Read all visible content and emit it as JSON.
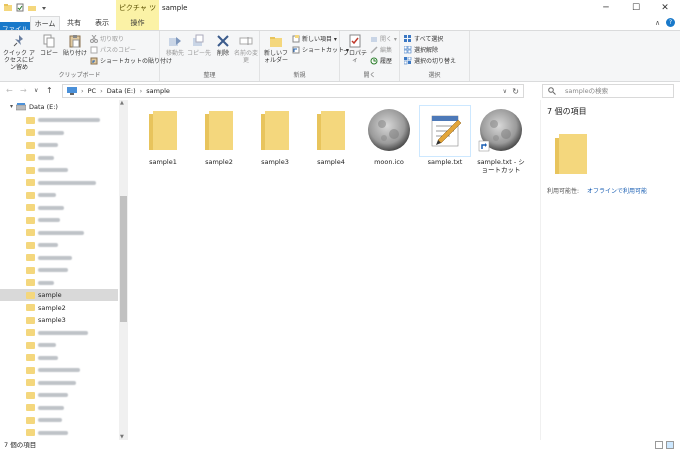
{
  "window": {
    "title": "sample",
    "context_tab": "ピクチャ ツール",
    "minimize": "─",
    "maximize": "☐",
    "close": "✕"
  },
  "tabs": [
    {
      "label": "ファイル"
    },
    {
      "label": "ホーム"
    },
    {
      "label": "共有"
    },
    {
      "label": "表示"
    },
    {
      "label": "操作"
    }
  ],
  "ribbon": {
    "clipboard": {
      "label": "クリップボード",
      "pin": "クイック アクセスにピン留め",
      "copy": "コピー",
      "paste": "貼り付け",
      "cut": "切り取り",
      "copy_path": "パスのコピー",
      "paste_shortcut": "ショートカットの貼り付け"
    },
    "organize": {
      "label": "整理",
      "move_to": "移動先",
      "copy_to": "コピー先",
      "delete": "削除",
      "rename": "名前の変更"
    },
    "new": {
      "label": "新規",
      "new_folder": "新しいフォルダー",
      "new_item": "新しい項目 ▾",
      "shortcut": "ショートカット ▾"
    },
    "open": {
      "label": "開く",
      "properties": "プロパティ",
      "open": "開く ▾",
      "edit": "編集",
      "history": "履歴"
    },
    "select": {
      "label": "選択",
      "select_all": "すべて選択",
      "select_none": "選択解除",
      "invert": "選択の切り替え"
    }
  },
  "address": {
    "back": "←",
    "forward": "→",
    "recent": "∨",
    "up": "↑",
    "crumbs": [
      "PC",
      "Data (E:)",
      "sample"
    ],
    "sep": "›",
    "refresh": "↻",
    "dropdown": "∨",
    "search_placeholder": "sampleの検索"
  },
  "nav": {
    "drive": "Data (E:)",
    "items": [
      {
        "label": "",
        "blur": 62
      },
      {
        "label": "",
        "blur": 26
      },
      {
        "label": "",
        "blur": 20
      },
      {
        "label": "",
        "blur": 16
      },
      {
        "label": "",
        "blur": 30
      },
      {
        "label": "",
        "blur": 58
      },
      {
        "label": "",
        "blur": 18
      },
      {
        "label": "",
        "blur": 26
      },
      {
        "label": "",
        "blur": 22
      },
      {
        "label": "",
        "blur": 46
      },
      {
        "label": "",
        "blur": 20
      },
      {
        "label": "",
        "blur": 34
      },
      {
        "label": "",
        "blur": 30
      },
      {
        "label": "",
        "blur": 16
      },
      {
        "label": "sample",
        "blur": 0,
        "selected": true
      },
      {
        "label": "sample2",
        "blur": 0
      },
      {
        "label": "sample3",
        "blur": 0
      },
      {
        "label": "",
        "blur": 50
      },
      {
        "label": "",
        "blur": 18
      },
      {
        "label": "",
        "blur": 20
      },
      {
        "label": "",
        "blur": 42
      },
      {
        "label": "",
        "blur": 38
      },
      {
        "label": "",
        "blur": 30
      },
      {
        "label": "",
        "blur": 26
      },
      {
        "label": "",
        "blur": 24
      },
      {
        "label": "",
        "blur": 30
      }
    ]
  },
  "files": [
    {
      "name": "sample1",
      "type": "folder"
    },
    {
      "name": "sample2",
      "type": "folder"
    },
    {
      "name": "sample3",
      "type": "folder"
    },
    {
      "name": "sample4",
      "type": "folder"
    },
    {
      "name": "moon.ico",
      "type": "moon"
    },
    {
      "name": "sample.txt",
      "type": "txt",
      "selected": true
    },
    {
      "name": "sample.txt - ショートカット",
      "type": "moon-shortcut"
    }
  ],
  "details": {
    "count": "7 個の項目",
    "availability_label": "利用可能性:",
    "availability_value": "オフラインで利用可能"
  },
  "status": {
    "count": "7 個の項目"
  },
  "colors": {
    "accent": "#1979ca",
    "folder": "#f4d77d",
    "context_tab": "#fbf2a6"
  }
}
